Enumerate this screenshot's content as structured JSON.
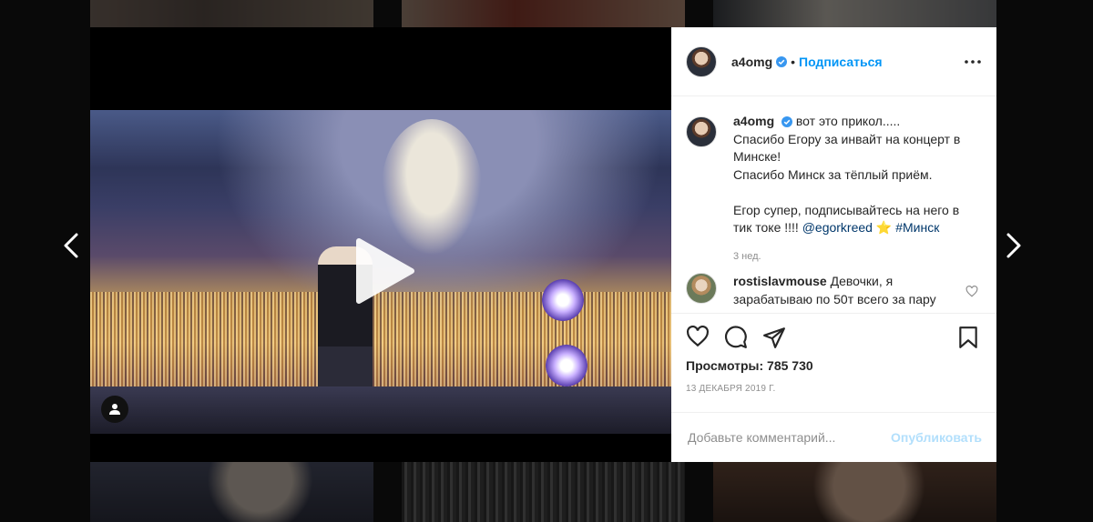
{
  "post": {
    "username": "a4omg",
    "follow_label": "Подписаться",
    "separator": "•",
    "caption_lines": [
      "вот это прикол.....",
      "Спасибо Егору за инвайт на концерт в",
      "Минске!",
      "Спасибо Минск за тёплый приём.",
      "",
      "Егор супер, подписывайтесь на него в",
      "тик токе !!!! "
    ],
    "caption_mention": "@egorkreed",
    "caption_emoji": "⭐",
    "caption_hashtag": "#Минск",
    "time_ago": "3 нед.",
    "reply": {
      "username": "rostislavmouse",
      "text": "Девочки, я зарабатываю по 50т всего за пару"
    },
    "views_label": "Просмотры: 785 730",
    "date": "13 декабря 2019 г.",
    "comment_placeholder": "Добавьте комментарий...",
    "publish_label": "Опубликовать"
  },
  "icons": {
    "verified": "verified-badge-icon",
    "more": "more-options-icon",
    "like": "heart-icon",
    "comment": "comment-icon",
    "share": "share-icon",
    "save": "bookmark-icon",
    "play": "play-icon",
    "user_tag": "user-tag-icon",
    "prev": "chevron-left-icon",
    "next": "chevron-right-icon"
  },
  "colors": {
    "accent": "#0095f6",
    "publish_disabled": "#b2dffc",
    "muted": "#8e8e8e",
    "text": "#262626"
  }
}
